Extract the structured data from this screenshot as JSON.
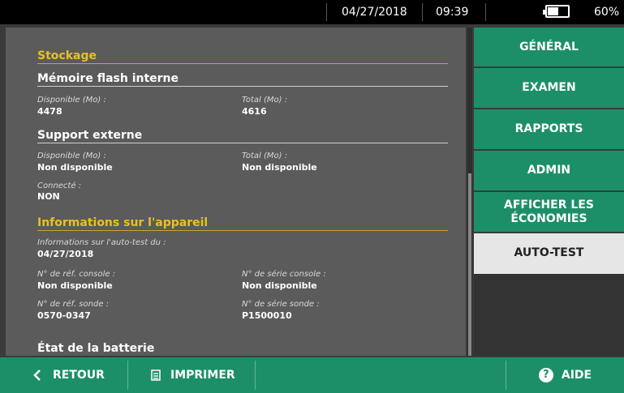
{
  "status": {
    "date": "04/27/2018",
    "time": "09:39",
    "battery_percent": "60%",
    "battery_level": 0.6
  },
  "storage": {
    "title": "Stockage",
    "internal": {
      "title": "Mémoire flash interne",
      "available_label": "Disponible (Mo) :",
      "available_value": "4478",
      "total_label": "Total (Mo) :",
      "total_value": "4616"
    },
    "external": {
      "title": "Support externe",
      "available_label": "Disponible (Mo) :",
      "available_value": "Non disponible",
      "total_label": "Total (Mo) :",
      "total_value": "Non disponible",
      "connected_label": "Connecté :",
      "connected_value": "NON"
    }
  },
  "device": {
    "title": "Informations sur l'appareil",
    "selftest_label": "Informations sur l'auto-test du :",
    "selftest_value": "04/27/2018",
    "console_ref_label": "N° de réf. console :",
    "console_ref_value": "Non disponible",
    "console_serial_label": "N° de série console :",
    "console_serial_value": "Non disponible",
    "probe_ref_label": "N° de réf. sonde :",
    "probe_ref_value": "0570-0347",
    "probe_serial_label": "N° de série sonde :",
    "probe_serial_value": "P1500010"
  },
  "battery_section": {
    "title": "État de la batterie"
  },
  "tabs": [
    {
      "label": "GÉNÉRAL"
    },
    {
      "label": "EXAMEN"
    },
    {
      "label": "RAPPORTS"
    },
    {
      "label": "ADMIN"
    },
    {
      "label_line1": "AFFICHER LES",
      "label_line2": "ÉCONOMIES"
    },
    {
      "label": "AUTO-TEST"
    }
  ],
  "bottom": {
    "back": "RETOUR",
    "print": "IMPRIMER",
    "help": "AIDE"
  },
  "colors": {
    "accent_green": "#1c8f69",
    "section_gold": "#e8c11f",
    "content_bg": "#5b5b5b"
  },
  "icons": {
    "back": "chevron-left-icon",
    "print": "print-icon",
    "help": "help-icon",
    "battery": "battery-icon"
  }
}
